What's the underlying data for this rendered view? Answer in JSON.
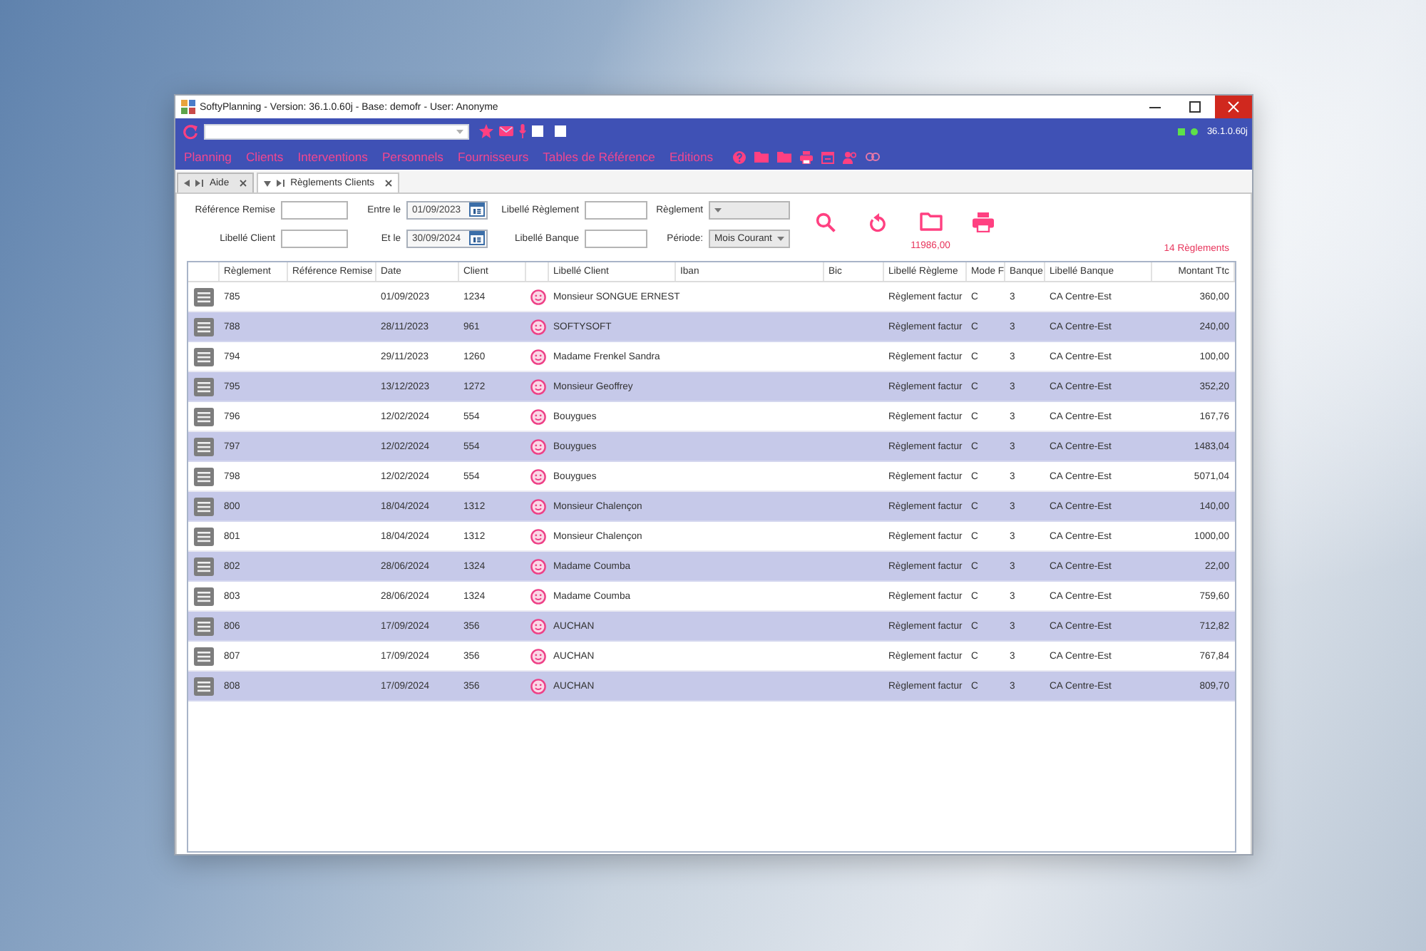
{
  "window": {
    "title": "SoftyPlanning - Version: 36.1.0.60j - Base: demofr - User: Anonyme"
  },
  "toolbar": {
    "version": "36.1.0.60j"
  },
  "menu": [
    "Planning",
    "Clients",
    "Interventions",
    "Personnels",
    "Fournisseurs",
    "Tables de Référence",
    "Editions"
  ],
  "tabs": [
    {
      "label": "Aide",
      "selected": false
    },
    {
      "label": "Règlements Clients",
      "selected": true
    }
  ],
  "filters": [
    {
      "label": "Référence Remise",
      "kind": "text"
    },
    {
      "label": "Entre le",
      "kind": "date",
      "value": "01/09/2023"
    },
    {
      "label": "Libellé Règlement",
      "kind": "text"
    },
    {
      "label": "Règlement",
      "kind": "select"
    },
    {
      "label": "Libellé Client",
      "kind": "text"
    },
    {
      "label": "Et le",
      "kind": "date",
      "value": "30/09/2024"
    },
    {
      "label": "Libellé Banque",
      "kind": "text"
    },
    {
      "label": "Période:",
      "kind": "select",
      "value": "Mois Courant"
    }
  ],
  "summary": {
    "total": "11986,00",
    "count": "14 Règlements"
  },
  "table": {
    "columns": [
      "Règlement",
      "Référence Remise",
      "Date",
      "Client",
      "Libellé Client",
      "Iban",
      "Bic",
      "Libellé Règleme",
      "Mode F",
      "Banque",
      "Libellé Banque",
      "Montant Ttc"
    ],
    "rows": [
      {
        "reglement": "785",
        "date": "01/09/2023",
        "client": "1234",
        "libelle_client": "Monsieur SONGUE ERNEST",
        "libelle_reglement": "Règlement factur",
        "mode": "C",
        "banque": "3",
        "libelle_banque": "CA Centre-Est",
        "montant": "360,00"
      },
      {
        "reglement": "788",
        "date": "28/11/2023",
        "client": "961",
        "libelle_client": "SOFTYSOFT",
        "libelle_reglement": "Règlement factur",
        "mode": "C",
        "banque": "3",
        "libelle_banque": "CA Centre-Est",
        "montant": "240,00"
      },
      {
        "reglement": "794",
        "date": "29/11/2023",
        "client": "1260",
        "libelle_client": "Madame Frenkel Sandra",
        "libelle_reglement": "Règlement factur",
        "mode": "C",
        "banque": "3",
        "libelle_banque": "CA Centre-Est",
        "montant": "100,00"
      },
      {
        "reglement": "795",
        "date": "13/12/2023",
        "client": "1272",
        "libelle_client": "Monsieur Geoffrey",
        "libelle_reglement": "Règlement factur",
        "mode": "C",
        "banque": "3",
        "libelle_banque": "CA Centre-Est",
        "montant": "352,20"
      },
      {
        "reglement": "796",
        "date": "12/02/2024",
        "client": "554",
        "libelle_client": "Bouygues",
        "libelle_reglement": "Règlement factur",
        "mode": "C",
        "banque": "3",
        "libelle_banque": "CA Centre-Est",
        "montant": "167,76"
      },
      {
        "reglement": "797",
        "date": "12/02/2024",
        "client": "554",
        "libelle_client": "Bouygues",
        "libelle_reglement": "Règlement factur",
        "mode": "C",
        "banque": "3",
        "libelle_banque": "CA Centre-Est",
        "montant": "1483,04"
      },
      {
        "reglement": "798",
        "date": "12/02/2024",
        "client": "554",
        "libelle_client": "Bouygues",
        "libelle_reglement": "Règlement factur",
        "mode": "C",
        "banque": "3",
        "libelle_banque": "CA Centre-Est",
        "montant": "5071,04"
      },
      {
        "reglement": "800",
        "date": "18/04/2024",
        "client": "1312",
        "libelle_client": "Monsieur Chalençon",
        "libelle_reglement": "Règlement factur",
        "mode": "C",
        "banque": "3",
        "libelle_banque": "CA Centre-Est",
        "montant": "140,00"
      },
      {
        "reglement": "801",
        "date": "18/04/2024",
        "client": "1312",
        "libelle_client": "Monsieur Chalençon",
        "libelle_reglement": "Règlement factur",
        "mode": "C",
        "banque": "3",
        "libelle_banque": "CA Centre-Est",
        "montant": "1000,00"
      },
      {
        "reglement": "802",
        "date": "28/06/2024",
        "client": "1324",
        "libelle_client": "Madame Coumba",
        "libelle_reglement": "Règlement factur",
        "mode": "C",
        "banque": "3",
        "libelle_banque": "CA Centre-Est",
        "montant": "22,00"
      },
      {
        "reglement": "803",
        "date": "28/06/2024",
        "client": "1324",
        "libelle_client": "Madame Coumba",
        "libelle_reglement": "Règlement factur",
        "mode": "C",
        "banque": "3",
        "libelle_banque": "CA Centre-Est",
        "montant": "759,60"
      },
      {
        "reglement": "806",
        "date": "17/09/2024",
        "client": "356",
        "libelle_client": "AUCHAN",
        "libelle_reglement": "Règlement factur",
        "mode": "C",
        "banque": "3",
        "libelle_banque": "CA Centre-Est",
        "montant": "712,82"
      },
      {
        "reglement": "807",
        "date": "17/09/2024",
        "client": "356",
        "libelle_client": "AUCHAN",
        "libelle_reglement": "Règlement factur",
        "mode": "C",
        "banque": "3",
        "libelle_banque": "CA Centre-Est",
        "montant": "767,84"
      },
      {
        "reglement": "808",
        "date": "17/09/2024",
        "client": "356",
        "libelle_client": "AUCHAN",
        "libelle_reglement": "Règlement factur",
        "mode": "C",
        "banque": "3",
        "libelle_banque": "CA Centre-Est",
        "montant": "809,70"
      }
    ]
  }
}
